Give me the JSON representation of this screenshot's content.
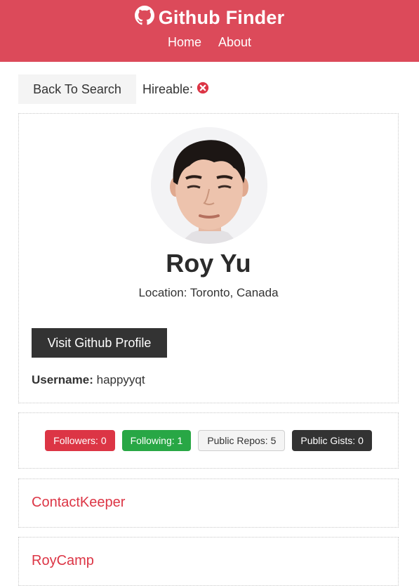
{
  "navbar": {
    "brand": "Github Finder",
    "links": [
      "Home",
      "About"
    ]
  },
  "toolbar": {
    "back_label": "Back To Search",
    "hireable_label": "Hireable:",
    "hireable_icon": "times-circle-icon"
  },
  "profile": {
    "name": "Roy Yu",
    "location": "Location: Toronto, Canada",
    "visit_label": "Visit Github Profile",
    "username_label": "Username:",
    "username": "happyyqt"
  },
  "stats": {
    "followers": "Followers: 0",
    "following": "Following: 1",
    "public_repos": "Public Repos: 5",
    "public_gists": "Public Gists: 0"
  },
  "repos": [
    "ContactKeeper",
    "RoyCamp"
  ],
  "colors": {
    "navbar": "#dc4a5a",
    "danger": "#dc3545",
    "success": "#28a745",
    "dark": "#333333",
    "light": "#f4f4f4"
  }
}
